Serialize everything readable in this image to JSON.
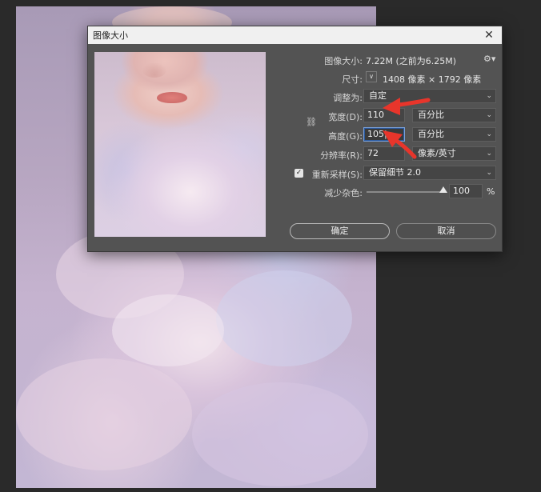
{
  "dialog": {
    "title": "图像大小",
    "close_glyph": "✕"
  },
  "form": {
    "image_size_label": "图像大小:",
    "image_size_value": "7.22M (之前为6.25M)",
    "dimensions_label": "尺寸:",
    "dimensions_value": "1408 像素 × 1792 像素",
    "fit_to_label": "调整为:",
    "fit_to_value": "自定",
    "width_label": "宽度(D):",
    "width_value": "110",
    "width_unit": "百分比",
    "height_label": "高度(G):",
    "height_value": "105",
    "height_unit": "百分比",
    "resolution_label": "分辨率(R):",
    "resolution_value": "72",
    "resolution_unit": "像素/英寸",
    "resample_label": "重新采样(S):",
    "resample_checked": true,
    "resample_value": "保留细节 2.0",
    "noise_label": "减少杂色:",
    "noise_value": "100",
    "noise_unit": "%",
    "ok_label": "确定",
    "cancel_label": "取消"
  },
  "icons": {
    "gear": "gear-icon",
    "chain": "link-icon",
    "chevron": "chevron-down-icon",
    "checkbox": "checkmark-icon"
  },
  "colors": {
    "dialog_bg": "#535353",
    "annotation_red": "#e8352b",
    "focus_blue": "#7aa0d8"
  }
}
